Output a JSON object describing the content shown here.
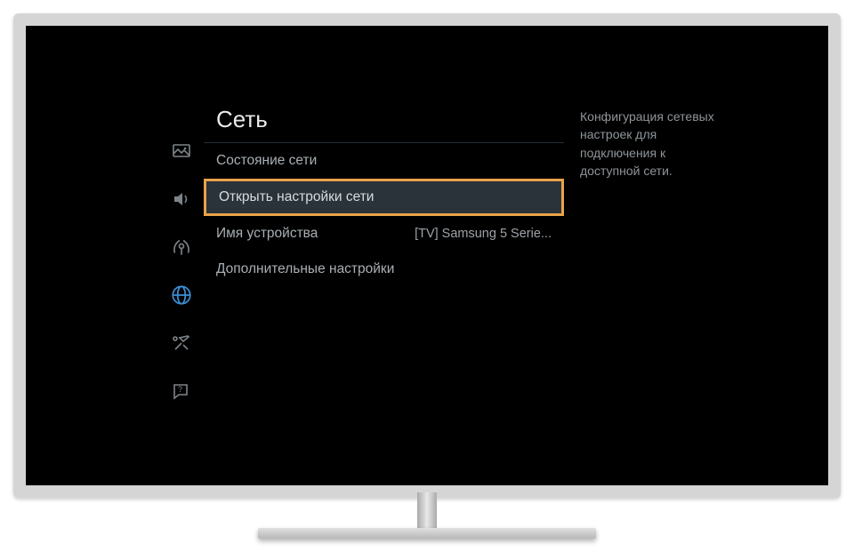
{
  "menu": {
    "title": "Сеть",
    "items": [
      {
        "label": "Состояние сети",
        "value": ""
      },
      {
        "label": "Открыть настройки сети",
        "value": ""
      },
      {
        "label": "Имя устройства",
        "value": "[TV] Samsung 5 Serie..."
      },
      {
        "label": "Дополнительные настройки",
        "value": ""
      }
    ]
  },
  "description": "Конфигурация сетевых настроек для подключения к доступной сети.",
  "rail": {
    "picture": "picture-icon",
    "sound": "sound-icon",
    "broadcast": "broadcast-icon",
    "network": "network-icon",
    "system": "system-icon",
    "support": "support-icon"
  }
}
